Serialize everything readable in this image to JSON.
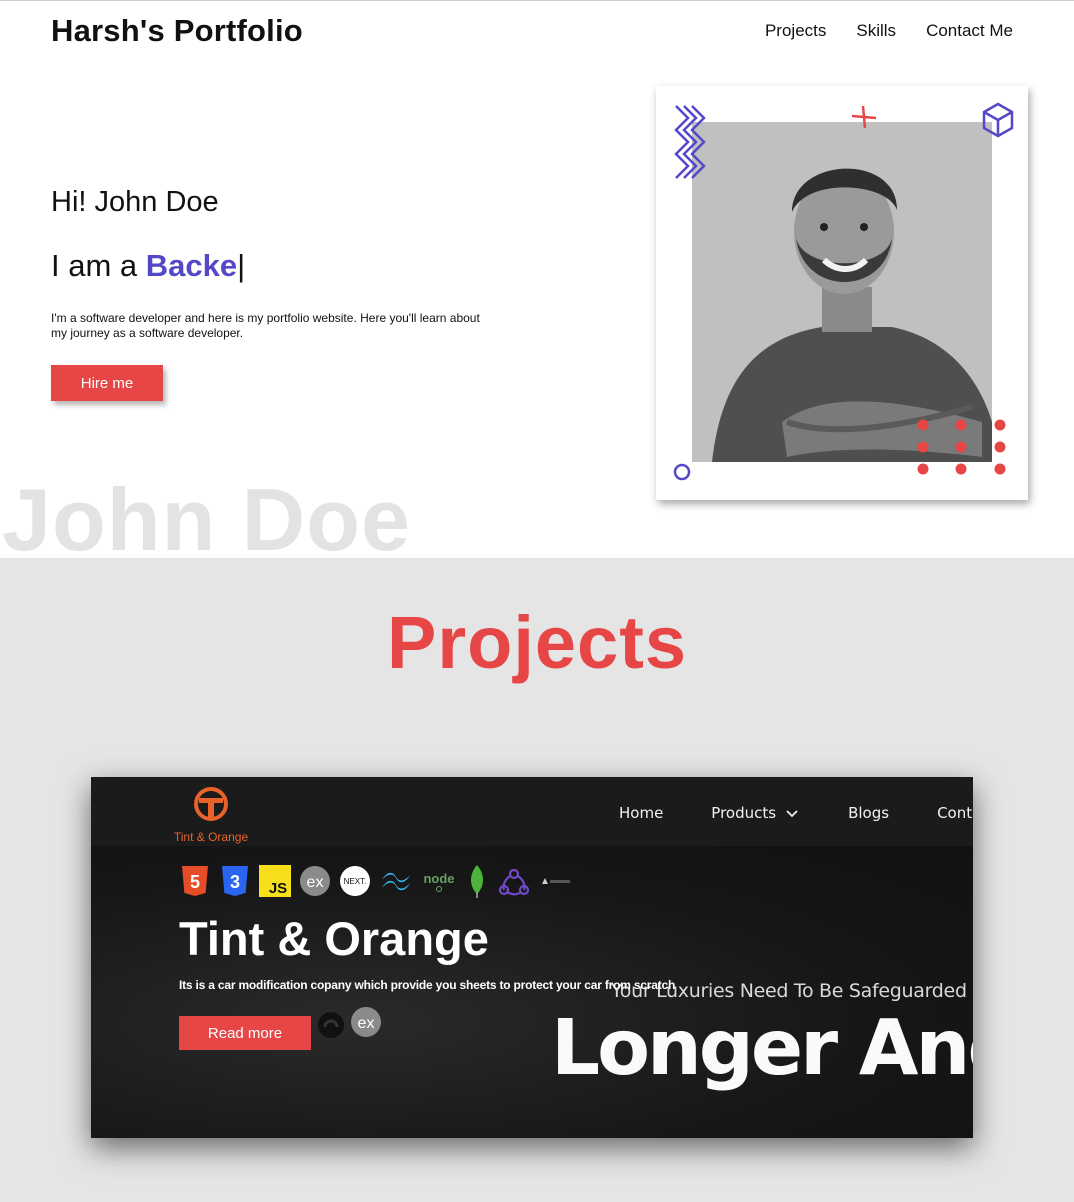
{
  "header": {
    "brand": "Harsh's Portfolio",
    "nav": [
      "Projects",
      "Skills",
      "Contact Me"
    ]
  },
  "hero": {
    "greeting": "Hi! John Doe",
    "role_prefix": "I am a ",
    "role_typed": "Backe",
    "cursor": "|",
    "intro": "I'm a software developer and here is my portfolio website. Here you'll learn about my journey as a software developer.",
    "hire_label": "Hire me",
    "ghost_name": "John Doe"
  },
  "projects": {
    "title": "Projects",
    "cards": [
      {
        "logo_text": "Tint & Orange",
        "nav": [
          "Home",
          "Products",
          "Blogs",
          "Contact U"
        ],
        "tech_icons": [
          "html5-icon",
          "css3-icon",
          "javascript-icon",
          "express-icon",
          "nextjs-icon",
          "tailwind-icon",
          "nodejs-icon",
          "mongodb-icon",
          "redux-icon",
          "vercel-icon",
          "github-icon",
          "express-icon"
        ],
        "title": "Tint & Orange",
        "description": "Its is a car modification copany which provide you sheets to protect your car from scratch",
        "tagline": "Your Luxuries Need To Be Safeguarded So",
        "headline": "Longer And",
        "read_more": "Read more"
      }
    ]
  },
  "colors": {
    "accent": "#e64646",
    "role": "#5548c8",
    "section_bg": "#e5e5e5",
    "ghost_text": "#e3e3e3",
    "card_bg": "#141414",
    "brand_orange": "#e8622a"
  }
}
